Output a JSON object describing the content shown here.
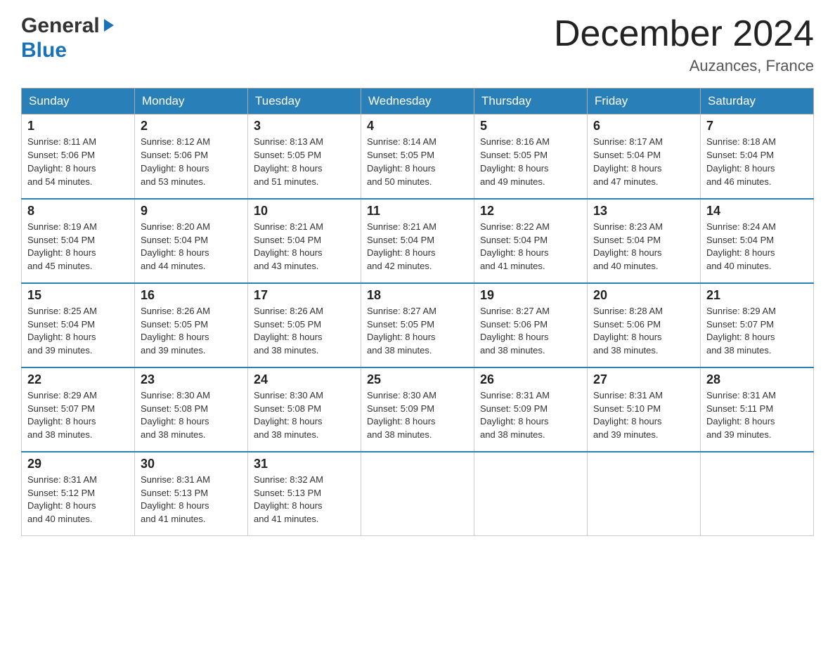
{
  "header": {
    "logo_line1": "General",
    "logo_line2": "Blue",
    "title": "December 2024",
    "subtitle": "Auzances, France"
  },
  "days_of_week": [
    "Sunday",
    "Monday",
    "Tuesday",
    "Wednesday",
    "Thursday",
    "Friday",
    "Saturday"
  ],
  "weeks": [
    [
      {
        "day": "1",
        "sunrise": "8:11 AM",
        "sunset": "5:06 PM",
        "daylight": "8 hours and 54 minutes."
      },
      {
        "day": "2",
        "sunrise": "8:12 AM",
        "sunset": "5:06 PM",
        "daylight": "8 hours and 53 minutes."
      },
      {
        "day": "3",
        "sunrise": "8:13 AM",
        "sunset": "5:05 PM",
        "daylight": "8 hours and 51 minutes."
      },
      {
        "day": "4",
        "sunrise": "8:14 AM",
        "sunset": "5:05 PM",
        "daylight": "8 hours and 50 minutes."
      },
      {
        "day": "5",
        "sunrise": "8:16 AM",
        "sunset": "5:05 PM",
        "daylight": "8 hours and 49 minutes."
      },
      {
        "day": "6",
        "sunrise": "8:17 AM",
        "sunset": "5:04 PM",
        "daylight": "8 hours and 47 minutes."
      },
      {
        "day": "7",
        "sunrise": "8:18 AM",
        "sunset": "5:04 PM",
        "daylight": "8 hours and 46 minutes."
      }
    ],
    [
      {
        "day": "8",
        "sunrise": "8:19 AM",
        "sunset": "5:04 PM",
        "daylight": "8 hours and 45 minutes."
      },
      {
        "day": "9",
        "sunrise": "8:20 AM",
        "sunset": "5:04 PM",
        "daylight": "8 hours and 44 minutes."
      },
      {
        "day": "10",
        "sunrise": "8:21 AM",
        "sunset": "5:04 PM",
        "daylight": "8 hours and 43 minutes."
      },
      {
        "day": "11",
        "sunrise": "8:21 AM",
        "sunset": "5:04 PM",
        "daylight": "8 hours and 42 minutes."
      },
      {
        "day": "12",
        "sunrise": "8:22 AM",
        "sunset": "5:04 PM",
        "daylight": "8 hours and 41 minutes."
      },
      {
        "day": "13",
        "sunrise": "8:23 AM",
        "sunset": "5:04 PM",
        "daylight": "8 hours and 40 minutes."
      },
      {
        "day": "14",
        "sunrise": "8:24 AM",
        "sunset": "5:04 PM",
        "daylight": "8 hours and 40 minutes."
      }
    ],
    [
      {
        "day": "15",
        "sunrise": "8:25 AM",
        "sunset": "5:04 PM",
        "daylight": "8 hours and 39 minutes."
      },
      {
        "day": "16",
        "sunrise": "8:26 AM",
        "sunset": "5:05 PM",
        "daylight": "8 hours and 39 minutes."
      },
      {
        "day": "17",
        "sunrise": "8:26 AM",
        "sunset": "5:05 PM",
        "daylight": "8 hours and 38 minutes."
      },
      {
        "day": "18",
        "sunrise": "8:27 AM",
        "sunset": "5:05 PM",
        "daylight": "8 hours and 38 minutes."
      },
      {
        "day": "19",
        "sunrise": "8:27 AM",
        "sunset": "5:06 PM",
        "daylight": "8 hours and 38 minutes."
      },
      {
        "day": "20",
        "sunrise": "8:28 AM",
        "sunset": "5:06 PM",
        "daylight": "8 hours and 38 minutes."
      },
      {
        "day": "21",
        "sunrise": "8:29 AM",
        "sunset": "5:07 PM",
        "daylight": "8 hours and 38 minutes."
      }
    ],
    [
      {
        "day": "22",
        "sunrise": "8:29 AM",
        "sunset": "5:07 PM",
        "daylight": "8 hours and 38 minutes."
      },
      {
        "day": "23",
        "sunrise": "8:30 AM",
        "sunset": "5:08 PM",
        "daylight": "8 hours and 38 minutes."
      },
      {
        "day": "24",
        "sunrise": "8:30 AM",
        "sunset": "5:08 PM",
        "daylight": "8 hours and 38 minutes."
      },
      {
        "day": "25",
        "sunrise": "8:30 AM",
        "sunset": "5:09 PM",
        "daylight": "8 hours and 38 minutes."
      },
      {
        "day": "26",
        "sunrise": "8:31 AM",
        "sunset": "5:09 PM",
        "daylight": "8 hours and 38 minutes."
      },
      {
        "day": "27",
        "sunrise": "8:31 AM",
        "sunset": "5:10 PM",
        "daylight": "8 hours and 39 minutes."
      },
      {
        "day": "28",
        "sunrise": "8:31 AM",
        "sunset": "5:11 PM",
        "daylight": "8 hours and 39 minutes."
      }
    ],
    [
      {
        "day": "29",
        "sunrise": "8:31 AM",
        "sunset": "5:12 PM",
        "daylight": "8 hours and 40 minutes."
      },
      {
        "day": "30",
        "sunrise": "8:31 AM",
        "sunset": "5:13 PM",
        "daylight": "8 hours and 41 minutes."
      },
      {
        "day": "31",
        "sunrise": "8:32 AM",
        "sunset": "5:13 PM",
        "daylight": "8 hours and 41 minutes."
      },
      null,
      null,
      null,
      null
    ]
  ],
  "labels": {
    "sunrise": "Sunrise:",
    "sunset": "Sunset:",
    "daylight": "Daylight:"
  }
}
